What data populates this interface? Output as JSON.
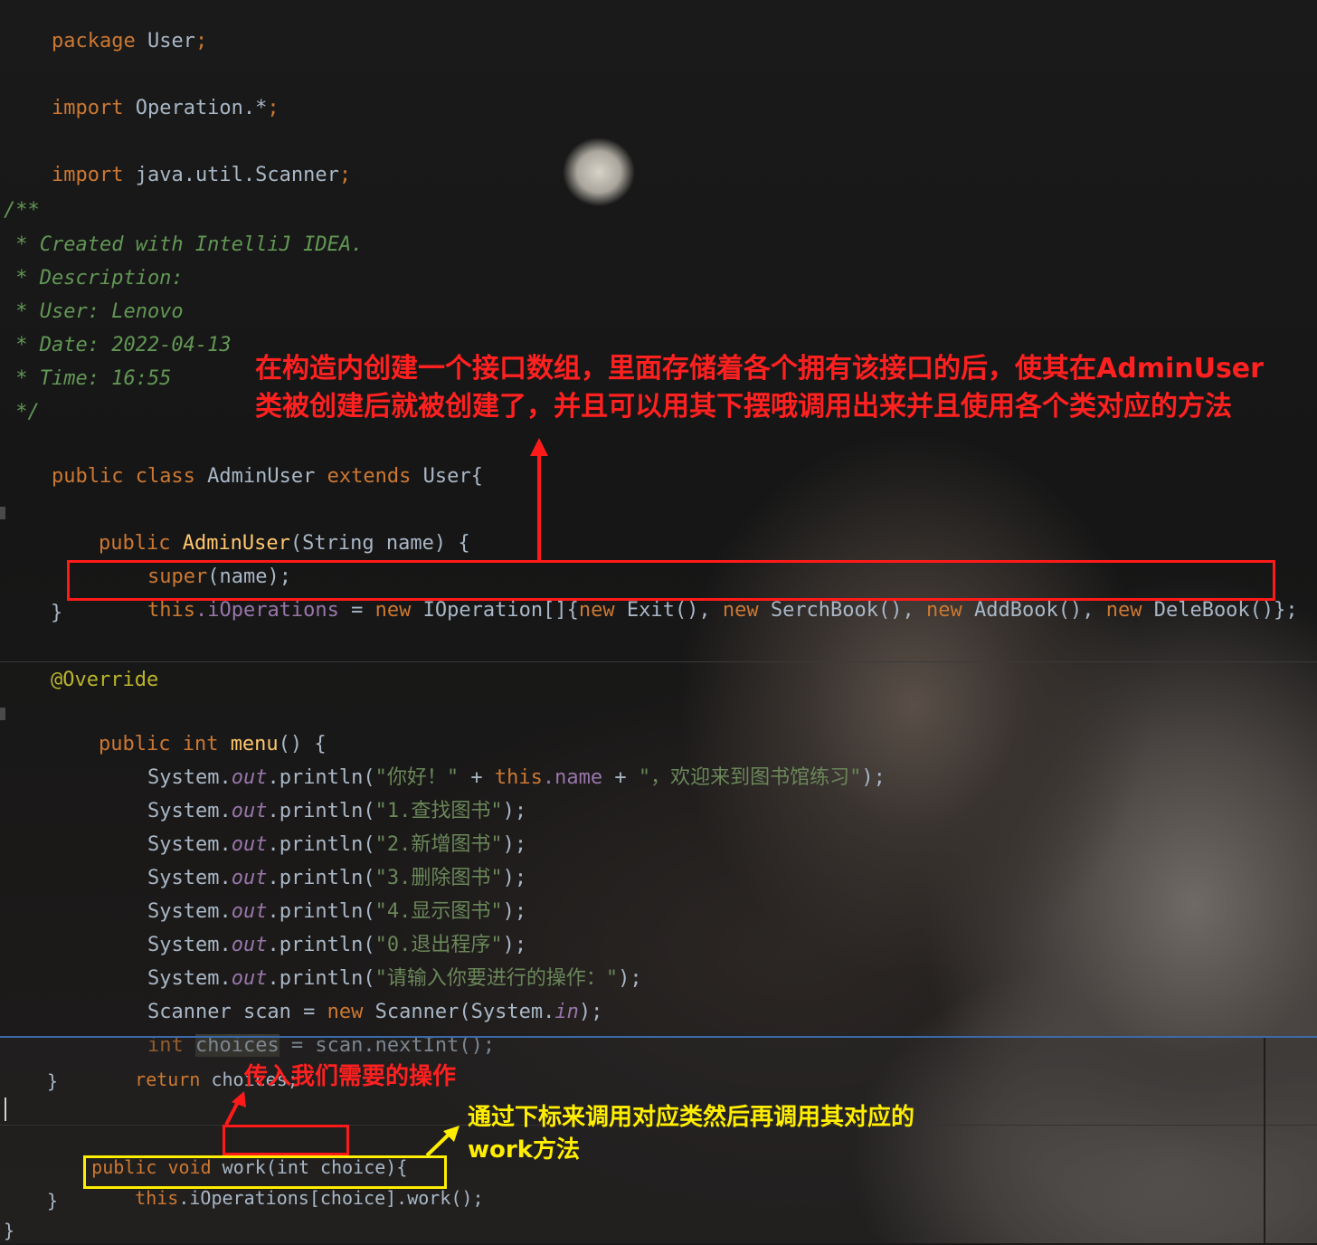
{
  "code_top": {
    "package_kw": "package",
    "package_name": " User",
    "semi": ";",
    "import1_kw": "import",
    "import1_name": " Operation.*",
    "import2_kw": "import",
    "import2_name": " java.util.Scanner",
    "doc_open": "/**",
    "doc_created": " * Created with IntelliJ IDEA.",
    "doc_desc": " * Description:",
    "doc_user": " * User: Lenovo",
    "doc_date": " * Date: 2022-04-13",
    "doc_time": " * Time: 16:55",
    "doc_close": " */",
    "class_public": "public class ",
    "class_name": "AdminUser ",
    "class_extends": "extends ",
    "class_parent": "User{",
    "ctor_public": "public ",
    "ctor_name": "AdminUser",
    "ctor_params": "(String name) {",
    "super_kw": "super",
    "super_args": "(name);",
    "this_kw": "this",
    "iops_field": ".iOperations",
    "assign": " = ",
    "new_kw": "new",
    "arr_type": " IOperation[]{",
    "new_exit": " Exit(), ",
    "new_serch": " SerchBook(), ",
    "new_add": " AddBook(), ",
    "new_dele": " DeleBook()};",
    "ctor_close": "}",
    "override": "@Override",
    "menu_public": "public int ",
    "menu_name": "menu",
    "menu_params": "() {",
    "sys": "System.",
    "out": "out",
    "println": ".println(",
    "p1_str1": "\"你好！\"",
    "p1_plus": " + ",
    "p1_this": "this",
    "p1_name": ".name",
    "p1_str2": "\"，欢迎来到图书馆练习\"",
    "p_end": ");",
    "p2": "\"1.查找图书\"",
    "p3": "\"2.新增图书\"",
    "p4": "\"3.删除图书\"",
    "p5": "\"4.显示图书\"",
    "p6": "\"0.退出程序\"",
    "p7": "\"请输入你要进行的操作：\"",
    "scanner_decl": "Scanner scan = ",
    "scanner_rest": " Scanner(System.",
    "scanner_in": "in",
    "int_kw": "int ",
    "choices": "choices",
    "next_int": " = scan.nextInt();"
  },
  "code_bottom": {
    "return_kw": "return",
    "return_val": " choices;",
    "close1": "}",
    "work_public": "public void ",
    "work_name": "work",
    "work_params": "(int choice){",
    "work_body_this": "this",
    "work_body_rest": ".iOperations[choice].work();",
    "close2": "}",
    "close3": "}"
  },
  "annotations": {
    "red_note_line1": "在构造内创建一个接口数组，里面存储着各个拥有该接口的后，使其在AdminUser",
    "red_note_line2": "类被创建后就被创建了，并且可以用其下摆哦调用出来并且使用各个类对应的方法",
    "red_note_small": "传入我们需要的操作",
    "yellow_note_line1": "通过下标来调用对应类然后再调用其对应的",
    "yellow_note_line2": "work方法"
  },
  "colors": {
    "keyword": "#cc7832",
    "comment": "#629755",
    "string": "#6a8759",
    "field": "#9876aa",
    "method": "#ffc66d",
    "annotation": "#bbb529",
    "red_box": "#ff1a1a",
    "yellow_box": "#ffee00"
  }
}
